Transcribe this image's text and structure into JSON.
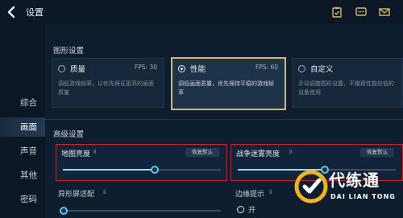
{
  "header": {
    "title": "设置"
  },
  "sidebar": {
    "items": [
      {
        "label": "综合",
        "active": false
      },
      {
        "label": "画面",
        "active": true
      },
      {
        "label": "声音",
        "active": false
      },
      {
        "label": "其他",
        "active": false
      },
      {
        "label": "密码",
        "active": false
      }
    ]
  },
  "graphics": {
    "section_title": "图形设置",
    "modes": [
      {
        "name": "质量",
        "fps": "FPS: 30",
        "desc": "调低游戏帧率，以优先保证更高的画面质量",
        "selected": false
      },
      {
        "name": "性能",
        "fps": "FPS: 60",
        "desc": "调低画面质量，优先保持平稳的游戏帧率",
        "selected": true
      },
      {
        "name": "自定义",
        "fps": "",
        "desc": "手动调整图形设置，不推荐性能较低的设备使用",
        "selected": false
      }
    ]
  },
  "advanced": {
    "section_title": "高级设置",
    "map_brightness": {
      "label": "地图亮度",
      "info": "ⅱ",
      "reset": "恢复默认",
      "value": 0.58
    },
    "fog_brightness": {
      "label": "战争迷雾亮度",
      "info": "ⅱ",
      "reset": "恢复默认",
      "value": 0.55
    },
    "special_screen": {
      "label": "异形屏适配",
      "info": "ⅱ"
    },
    "edge_hint": {
      "label": "边缘提示",
      "info": "ⅱ",
      "toggle_label": "开"
    }
  },
  "watermark": {
    "brand": "代练通",
    "sub": "DAI LIAN TONG"
  },
  "colors": {
    "accent": "#d9b66a",
    "highlight": "#c8232a",
    "slider": "#5ec6e8"
  }
}
